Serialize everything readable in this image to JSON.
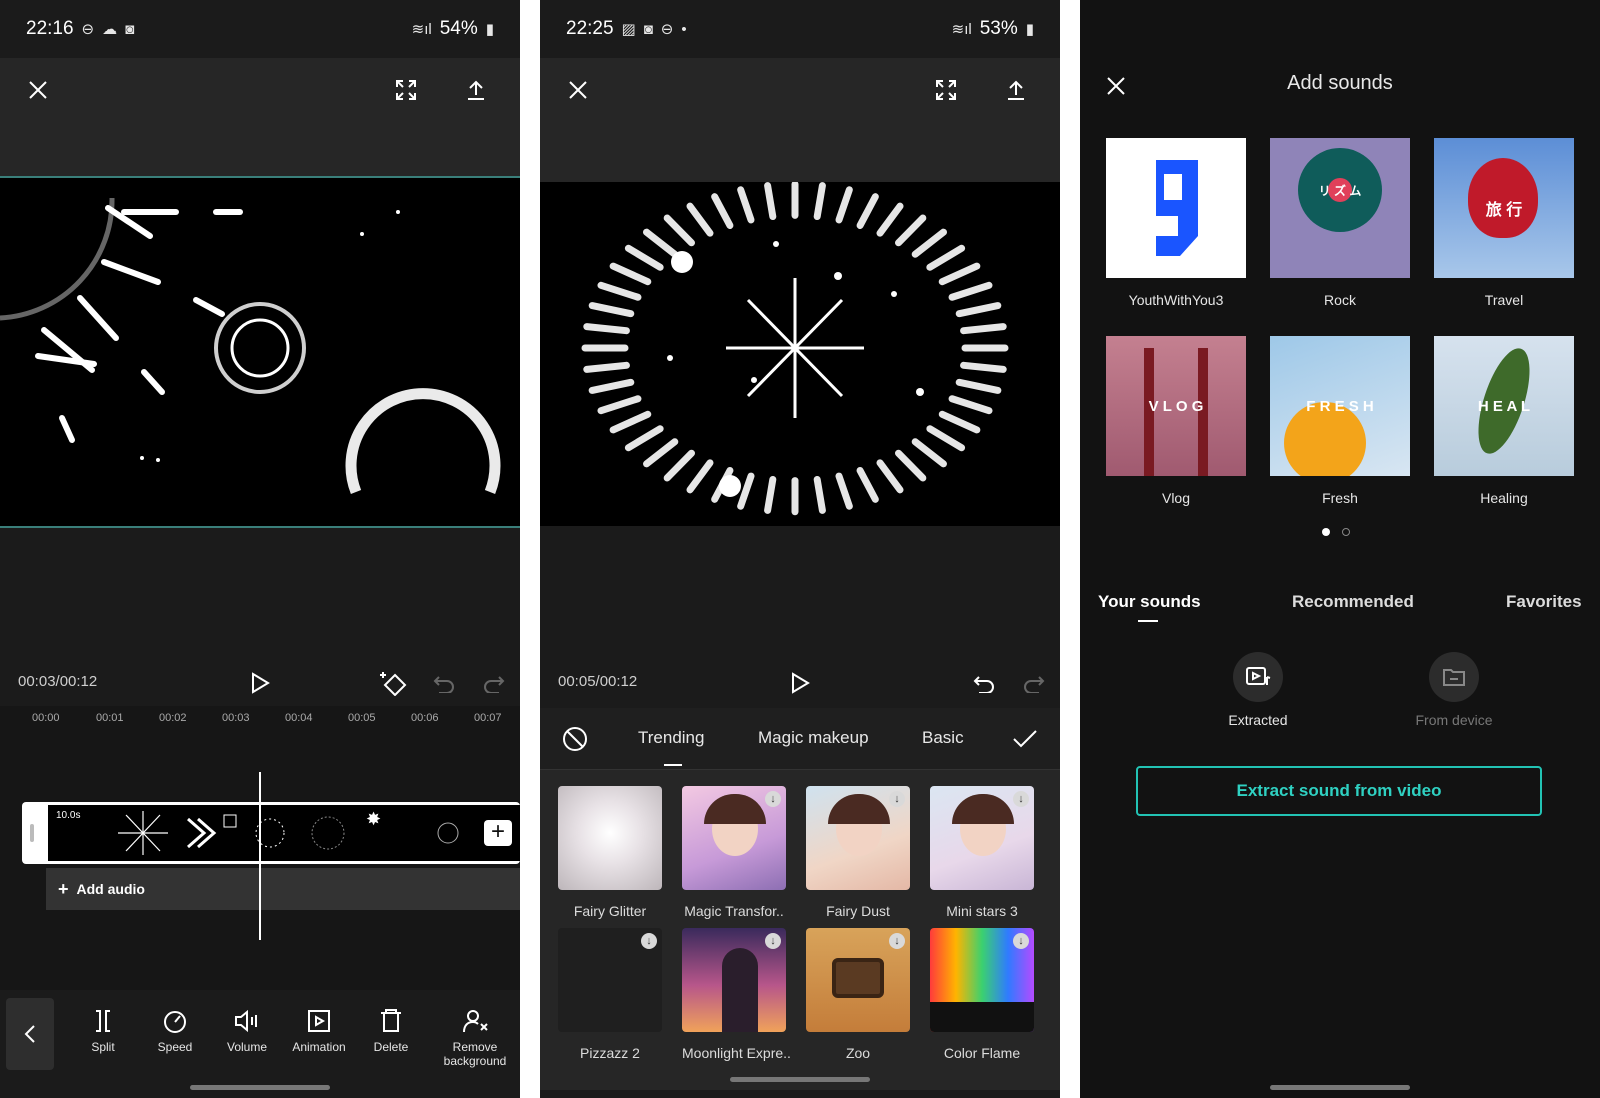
{
  "panel1": {
    "status": {
      "time": "22:16",
      "battery": "54%"
    },
    "timecode": "00:03/00:12",
    "ruler": [
      "00:00",
      "00:01",
      "00:02",
      "00:03",
      "00:04",
      "00:05",
      "00:06",
      "00:07"
    ],
    "clip_duration": "10.0s",
    "add_audio": "Add audio",
    "tools": [
      {
        "label": "Split",
        "icon": "split-icon"
      },
      {
        "label": "Speed",
        "icon": "speed-icon"
      },
      {
        "label": "Volume",
        "icon": "volume-icon"
      },
      {
        "label": "Animation",
        "icon": "animation-icon"
      },
      {
        "label": "Delete",
        "icon": "delete-icon"
      },
      {
        "label": "Remove background",
        "icon": "remove-background-icon"
      }
    ]
  },
  "panel2": {
    "status": {
      "time": "22:25",
      "battery": "53%"
    },
    "timecode": "00:05/00:12",
    "tabs": [
      "Trending",
      "Magic makeup",
      "Basic"
    ],
    "effects": [
      {
        "label": "Fairy Glitter",
        "download": false
      },
      {
        "label": "Magic Transfor..",
        "download": true
      },
      {
        "label": "Fairy Dust",
        "download": true
      },
      {
        "label": "Mini stars 3",
        "download": true
      },
      {
        "label": "Pizzazz 2",
        "download": true
      },
      {
        "label": "Moonlight Expre..",
        "download": true
      },
      {
        "label": "Zoo",
        "download": true
      },
      {
        "label": "Color Flame",
        "download": true
      }
    ]
  },
  "panel3": {
    "title": "Add sounds",
    "sounds": [
      {
        "label": "YouthWithYou3"
      },
      {
        "label": "Rock",
        "thumb_text": "リ ズ ム"
      },
      {
        "label": "Travel",
        "thumb_text": "旅 行"
      },
      {
        "label": "Vlog",
        "thumb_text": "V L O G"
      },
      {
        "label": "Fresh",
        "thumb_text": "F R E S H"
      },
      {
        "label": "Healing",
        "thumb_text": "H E A L"
      }
    ],
    "tabs": [
      "Your sounds",
      "Recommended",
      "Favorites"
    ],
    "sources": [
      "Extracted",
      "From device"
    ],
    "extract_button": "Extract sound from video",
    "accent": "#22c3b4"
  }
}
